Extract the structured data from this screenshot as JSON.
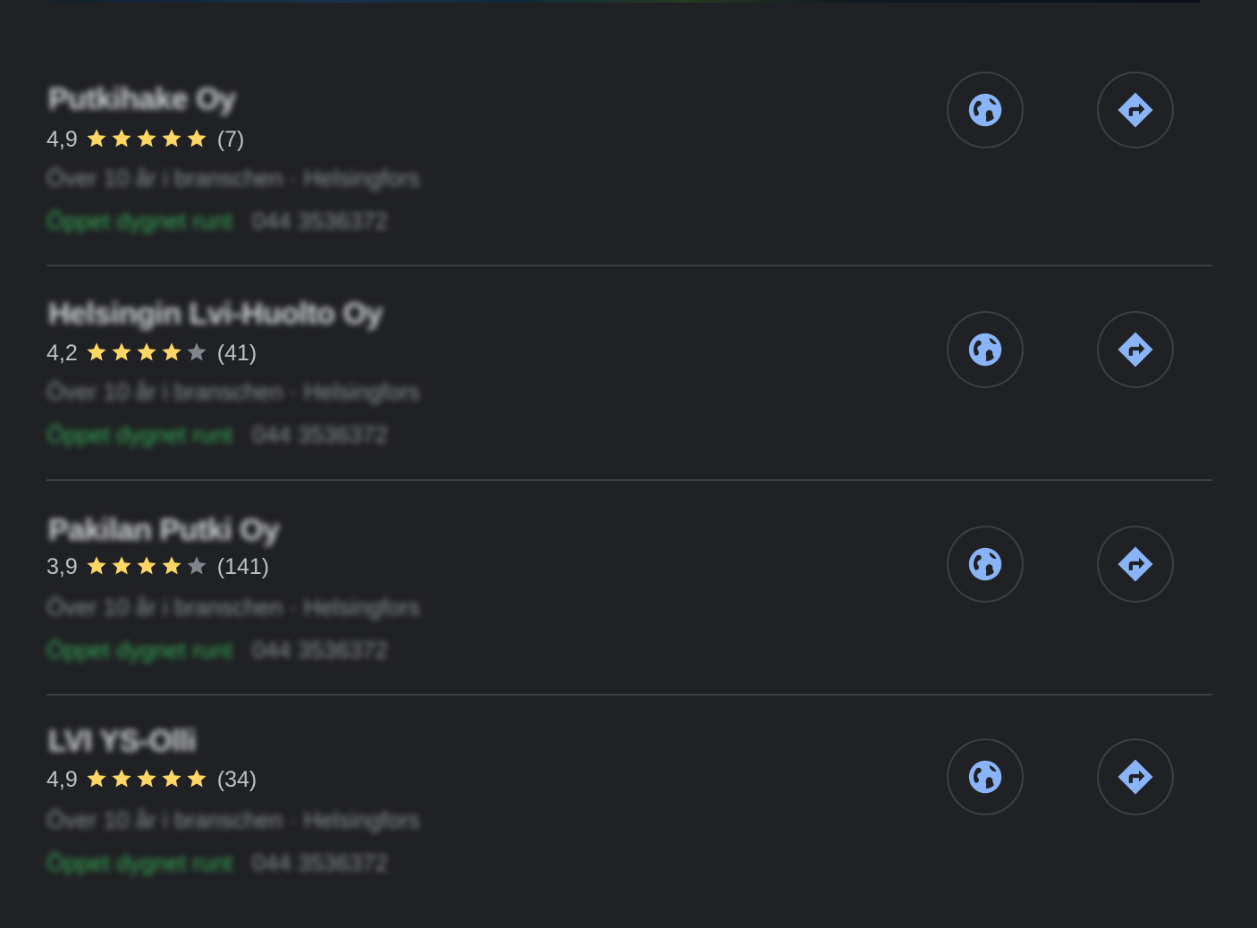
{
  "colors": {
    "background": "#202124",
    "star_filled": "#fdd663",
    "star_empty": "#80868b",
    "open_green": "#34a853",
    "icon_blue": "#8ab4f8",
    "divider": "#3c4043"
  },
  "icons": {
    "website": "globe-icon",
    "directions": "directions-icon"
  },
  "results": [
    {
      "name": "Putkihake Oy",
      "rating": "4,9",
      "stars": 5,
      "reviews": "(7)",
      "meta": "Över 10 år i branschen · Helsingfors",
      "hours": "Öppet dygnet runt",
      "phone": "044 3536372"
    },
    {
      "name": "Helsingin Lvi-Huolto Oy",
      "rating": "4,2",
      "stars": 4,
      "reviews": "(41)",
      "meta": "Över 10 år i branschen · Helsingfors",
      "hours": "Öppet dygnet runt",
      "phone": "044 3536372"
    },
    {
      "name": "Pakilan Putki Oy",
      "rating": "3,9",
      "stars": 4,
      "reviews": "(141)",
      "meta": "Över 10 år i branschen · Helsingfors",
      "hours": "Öppet dygnet runt",
      "phone": "044 3536372"
    },
    {
      "name": "LVI YS-Olli",
      "rating": "4,9",
      "stars": 5,
      "reviews": "(34)",
      "meta": "Över 10 år i branschen · Helsingfors",
      "hours": "Öppet dygnet runt",
      "phone": "044 3536372"
    }
  ]
}
